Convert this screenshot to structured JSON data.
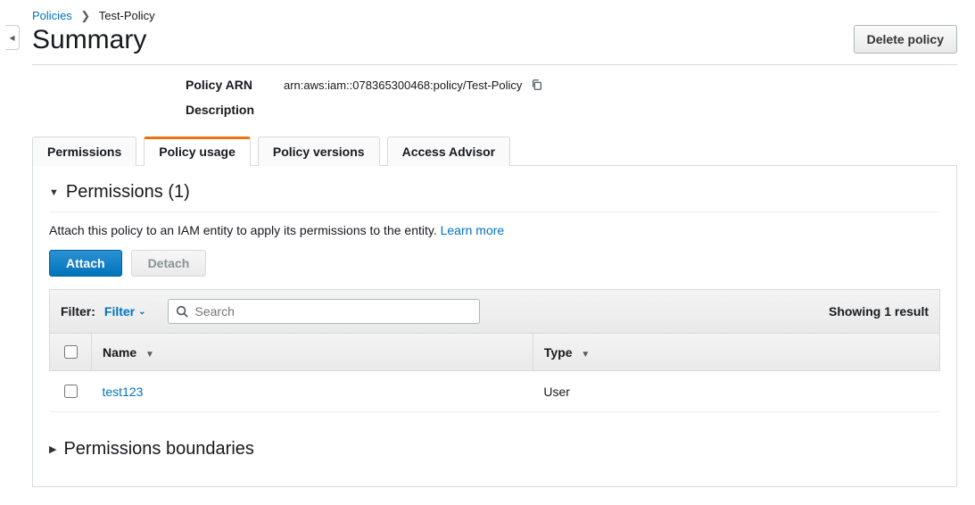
{
  "breadcrumb": {
    "root": "Policies",
    "current": "Test-Policy"
  },
  "header": {
    "title": "Summary",
    "delete_label": "Delete policy"
  },
  "details": {
    "arn_label": "Policy ARN",
    "arn_value": "arn:aws:iam::078365300468:policy/Test-Policy",
    "description_label": "Description"
  },
  "tabs": {
    "permissions": "Permissions",
    "usage": "Policy usage",
    "versions": "Policy versions",
    "advisor": "Access Advisor"
  },
  "usage": {
    "section_title": "Permissions (1)",
    "help_text": "Attach this policy to an IAM entity to apply its permissions to the entity. ",
    "learn_more": "Learn more",
    "attach_label": "Attach",
    "detach_label": "Detach",
    "filter_label": "Filter:",
    "filter_link": "Filter",
    "search_placeholder": "Search",
    "result_text": "Showing 1 result",
    "columns": {
      "name": "Name",
      "type": "Type"
    },
    "rows": [
      {
        "name": "test123",
        "type": "User"
      }
    ],
    "boundaries_title": "Permissions boundaries"
  }
}
